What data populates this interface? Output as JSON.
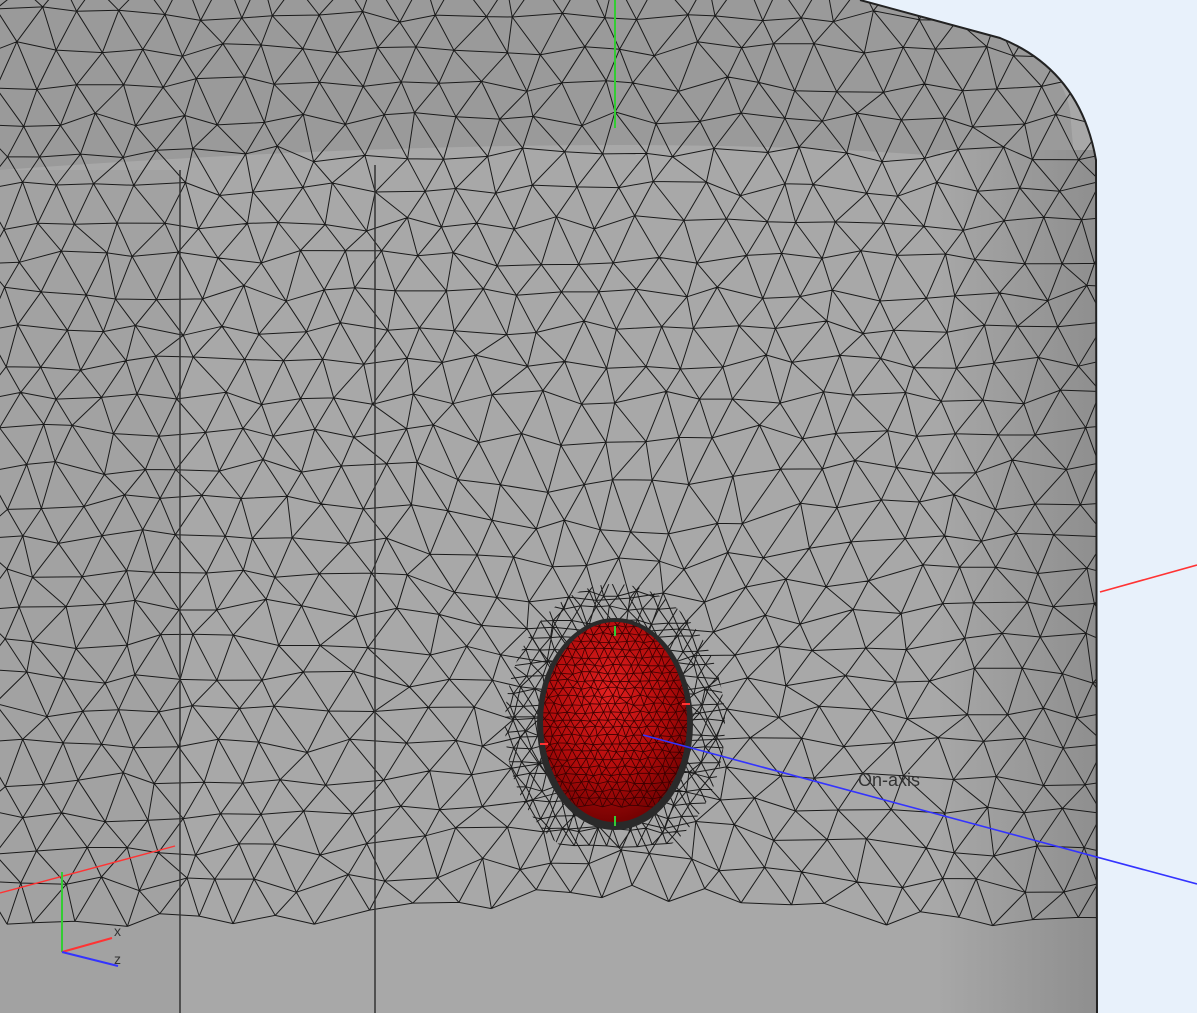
{
  "viewport": {
    "background_color": "#e8f1fb",
    "model_fill_color": "#a9a9a9",
    "mesh_line_color": "#1a1a1a",
    "hole_fill_color": "#c01010",
    "axis_colors": {
      "x": "#ff3333",
      "y": "#33cc33",
      "z": "#3333ff"
    }
  },
  "annotations": {
    "axis_label": "On-axis"
  },
  "triad": {
    "x_label": "x",
    "z_label": "z"
  }
}
